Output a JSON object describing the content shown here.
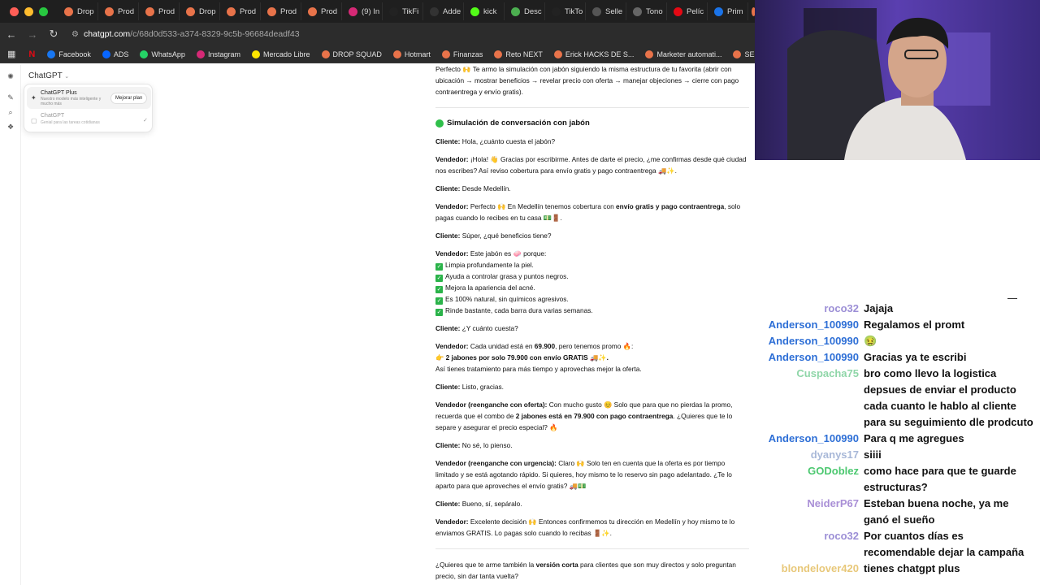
{
  "browser": {
    "tabs": [
      {
        "label": "Drop",
        "color": "#e8734a"
      },
      {
        "label": "Prod",
        "color": "#e8734a"
      },
      {
        "label": "Prod",
        "color": "#e8734a"
      },
      {
        "label": "Drop",
        "color": "#e8734a"
      },
      {
        "label": "Prod",
        "color": "#e8734a"
      },
      {
        "label": "Prod",
        "color": "#e8734a"
      },
      {
        "label": "Prod",
        "color": "#e8734a"
      },
      {
        "label": "(9) In",
        "color": "#d62976"
      },
      {
        "label": "TikFi",
        "color": "#222222"
      },
      {
        "label": "Adde",
        "color": "#333333"
      },
      {
        "label": "kick",
        "color": "#53fc18"
      },
      {
        "label": "Desc",
        "color": "#4caf50"
      },
      {
        "label": "TikTo",
        "color": "#222222"
      },
      {
        "label": "Selle",
        "color": "#555555"
      },
      {
        "label": "Tono",
        "color": "#666666"
      },
      {
        "label": "Pelíc",
        "color": "#e50914"
      },
      {
        "label": "Prim",
        "color": "#1a73e8"
      }
    ],
    "url_host": "chatgpt.com",
    "url_path": "/c/68d0d533-a374-8329-9c5b-96684deadf43",
    "bookmarks": [
      {
        "label": "Facebook",
        "color": "#1877f2"
      },
      {
        "label": "ADS",
        "color": "#0866ff"
      },
      {
        "label": "WhatsApp",
        "color": "#25d366"
      },
      {
        "label": "Instagram",
        "color": "#d62976"
      },
      {
        "label": "Mercado Libre",
        "color": "#ffe600"
      },
      {
        "label": "DROP SQUAD",
        "color": "#e8734a"
      },
      {
        "label": "Hotmart",
        "color": "#e8734a"
      },
      {
        "label": "Finanzas",
        "color": "#e8734a"
      },
      {
        "label": "Reto NEXT",
        "color": "#e8734a"
      },
      {
        "label": "Erick HACKS DE S...",
        "color": "#e8734a"
      },
      {
        "label": "Marketer automati...",
        "color": "#e8734a"
      },
      {
        "label": "SEMINARIOS ONLI...",
        "color": "#e8734a"
      }
    ]
  },
  "chatgpt": {
    "model_label": "ChatGPT",
    "plus_title": "ChatGPT Plus",
    "plus_desc": "Nuestro modelo más inteligente y mucho más",
    "upgrade_label": "Mejorar plan",
    "basic_title": "ChatGPT",
    "basic_desc": "Genial para las tareas cotidianas"
  },
  "conversation": {
    "intro": "Perfecto 🙌 Te armo la simulación con jabón siguiendo la misma estructura de tu favorita (abrir con ubicación → mostrar beneficios → revelar precio con oferta → manejar objeciones → cierre con pago contraentrega y envío gratis).",
    "heading": "Simulación de conversación con jabón",
    "c1_label": "Cliente:",
    "c1_text": "Hola, ¿cuánto cuesta el jabón?",
    "v1_label": "Vendedor:",
    "v1_text": "¡Hola! 👋 Gracias por escribirme. Antes de darte el precio, ¿me confirmas desde qué ciudad nos escribes? Así reviso cobertura para envío gratis y pago contraentrega 🚚✨.",
    "c2_label": "Cliente:",
    "c2_text": "Desde Medellín.",
    "v2_label": "Vendedor:",
    "v2_pre": "Perfecto 🙌 En Medellín tenemos cobertura con",
    "v2_bold": "envío gratis y pago contraentrega",
    "v2_post": ", solo pagas cuando lo recibes en tu casa 💵🚪.",
    "c3_label": "Cliente:",
    "c3_text": "Súper, ¿qué beneficios tiene?",
    "v3_label": "Vendedor:",
    "v3_text": "Este jabón es 🧼 porque:",
    "benefits": [
      "Limpia profundamente la piel.",
      "Ayuda a controlar grasa y puntos negros.",
      "Mejora la apariencia del acné.",
      "Es 100% natural, sin químicos agresivos.",
      "Rinde bastante, cada barra dura varias semanas."
    ],
    "c4_label": "Cliente:",
    "c4_text": "¿Y cuánto cuesta?",
    "v4_label": "Vendedor:",
    "v4_pre": "Cada unidad está en",
    "v4_price": "69.900",
    "v4_post": ", pero tenemos promo 🔥:",
    "v4_offer": "👉 2 jabones por solo 79.900 con envío GRATIS 🚚✨.",
    "v4_line3": "Así tienes tratamiento para más tiempo y aprovechas mejor la oferta.",
    "c5_label": "Cliente:",
    "c5_text": "Listo, gracias.",
    "v5_label": "Vendedor (reenganche con oferta):",
    "v5_pre": "Con mucho gusto 😊 Solo que para que no pierdas la promo, recuerda que el combo de",
    "v5_bold": "2 jabones está en 79.900 con pago contraentrega",
    "v5_post": ". ¿Quieres que te lo separe y asegurar el precio especial? 🔥",
    "c6_label": "Cliente:",
    "c6_text": "No sé, lo pienso.",
    "v6_label": "Vendedor (reenganche con urgencia):",
    "v6_text": "Claro 🙌 Solo ten en cuenta que la oferta es por tiempo limitado y se está agotando rápido. Si quieres, hoy mismo te lo reservo sin pago adelantado. ¿Te lo aparto para que aproveches el envío gratis? 🚚💵",
    "c7_label": "Cliente:",
    "c7_text": "Bueno, sí, sepáralo.",
    "v7_label": "Vendedor:",
    "v7_text": "Excelente decisión 🙌 Entonces confirmemos tu dirección en Medellín y hoy mismo te lo enviamos GRATIS. Lo pagas solo cuando lo recibas 🚪✨.",
    "closing_pre": "¿Quieres que te arme también la",
    "closing_bold": "versión corta",
    "closing_post": "para clientes que son muy directos y solo preguntan precio, sin dar tanta vuelta?"
  },
  "stream_chat": [
    {
      "user": "roco32",
      "color": "#9c8fd6",
      "text": "Jajaja"
    },
    {
      "user": "Anderson_100990",
      "color": "#2e6fd6",
      "text": "Regalamos el promt"
    },
    {
      "user": "Anderson_100990",
      "color": "#2e6fd6",
      "text": "🤢"
    },
    {
      "user": "Anderson_100990",
      "color": "#2e6fd6",
      "text": "Gracias ya te escribi"
    },
    {
      "user": "Cuspacha75",
      "color": "#8fd6a8",
      "text": "bro como llevo la logistica depsues de enviar el producto cada cuanto le hablo al cliente para su seguimiento dle prodcuto"
    },
    {
      "user": "Anderson_100990",
      "color": "#2e6fd6",
      "text": "Para q me agregues"
    },
    {
      "user": "dyanys17",
      "color": "#a8b8d8",
      "text": "siiii"
    },
    {
      "user": "GODoblez",
      "color": "#4cc870",
      "text": "como hace para que te guarde estructuras?"
    },
    {
      "user": "NeiderP67",
      "color": "#a98fd6",
      "text": "Esteban buena noche, ya me ganó el sueño"
    },
    {
      "user": "roco32",
      "color": "#9c8fd6",
      "text": "Por cuantos días es recomendable dejar la campaña"
    },
    {
      "user": "blondelover420",
      "color": "#e8c87a",
      "text": "tienes chatgpt plus"
    }
  ]
}
